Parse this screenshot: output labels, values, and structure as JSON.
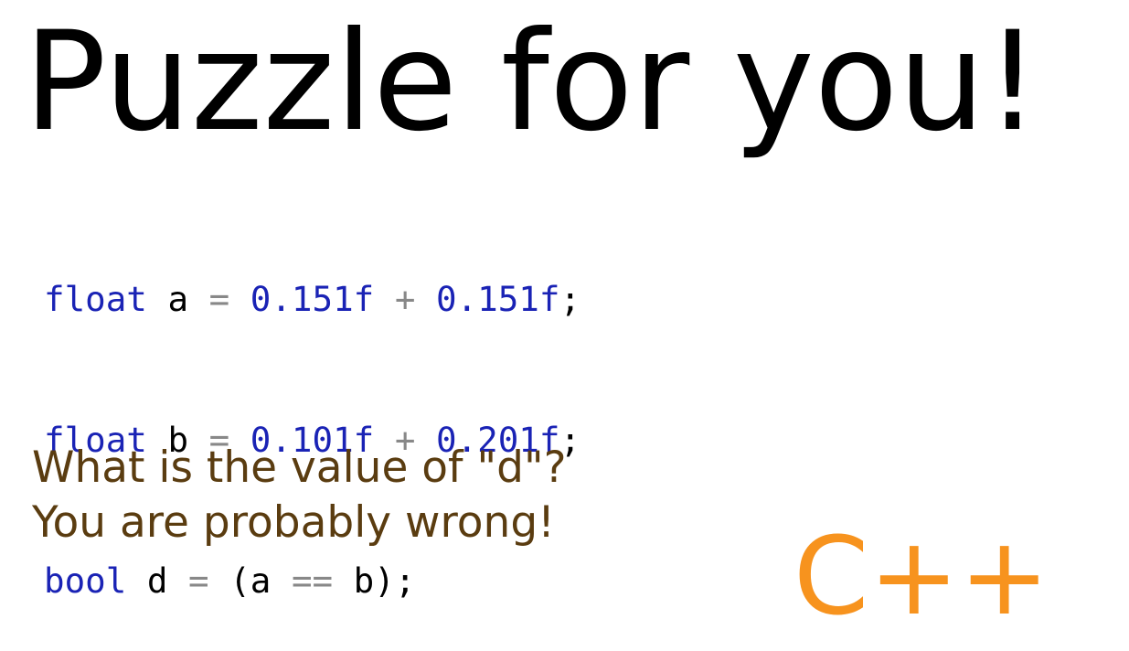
{
  "title": "Puzzle for you!",
  "code": {
    "lines": [
      {
        "tokens": [
          {
            "kind": "kw",
            "text": "float"
          },
          {
            "kind": "sp",
            "text": " "
          },
          {
            "kind": "id",
            "text": "a"
          },
          {
            "kind": "sp",
            "text": " "
          },
          {
            "kind": "op",
            "text": "="
          },
          {
            "kind": "sp",
            "text": " "
          },
          {
            "kind": "num",
            "text": "0.151f"
          },
          {
            "kind": "sp",
            "text": " "
          },
          {
            "kind": "op",
            "text": "+"
          },
          {
            "kind": "sp",
            "text": " "
          },
          {
            "kind": "num",
            "text": "0.151f"
          },
          {
            "kind": "punct",
            "text": ";"
          }
        ]
      },
      {
        "tokens": [
          {
            "kind": "kw",
            "text": "float"
          },
          {
            "kind": "sp",
            "text": " "
          },
          {
            "kind": "id",
            "text": "b"
          },
          {
            "kind": "sp",
            "text": " "
          },
          {
            "kind": "op",
            "text": "="
          },
          {
            "kind": "sp",
            "text": " "
          },
          {
            "kind": "num",
            "text": "0.101f"
          },
          {
            "kind": "sp",
            "text": " "
          },
          {
            "kind": "op",
            "text": "+"
          },
          {
            "kind": "sp",
            "text": " "
          },
          {
            "kind": "num",
            "text": "0.201f"
          },
          {
            "kind": "punct",
            "text": ";"
          }
        ]
      },
      {
        "tokens": [
          {
            "kind": "kw",
            "text": "bool"
          },
          {
            "kind": "sp",
            "text": " "
          },
          {
            "kind": "id",
            "text": "d"
          },
          {
            "kind": "sp",
            "text": " "
          },
          {
            "kind": "op",
            "text": "="
          },
          {
            "kind": "sp",
            "text": " "
          },
          {
            "kind": "punct",
            "text": "("
          },
          {
            "kind": "id",
            "text": "a"
          },
          {
            "kind": "sp",
            "text": " "
          },
          {
            "kind": "op",
            "text": "=="
          },
          {
            "kind": "sp",
            "text": " "
          },
          {
            "kind": "id",
            "text": "b"
          },
          {
            "kind": "punct",
            "text": ");"
          }
        ]
      }
    ]
  },
  "question": {
    "line1": "What is the value of \"d\"?",
    "line2": "You are probably wrong!"
  },
  "language_badge": "C++",
  "colors": {
    "title": "#000000",
    "keyword": "#1a23b5",
    "number": "#1a23b5",
    "operator": "#888888",
    "identifier": "#000000",
    "question": "#5a3c10",
    "badge": "#f7931e"
  }
}
